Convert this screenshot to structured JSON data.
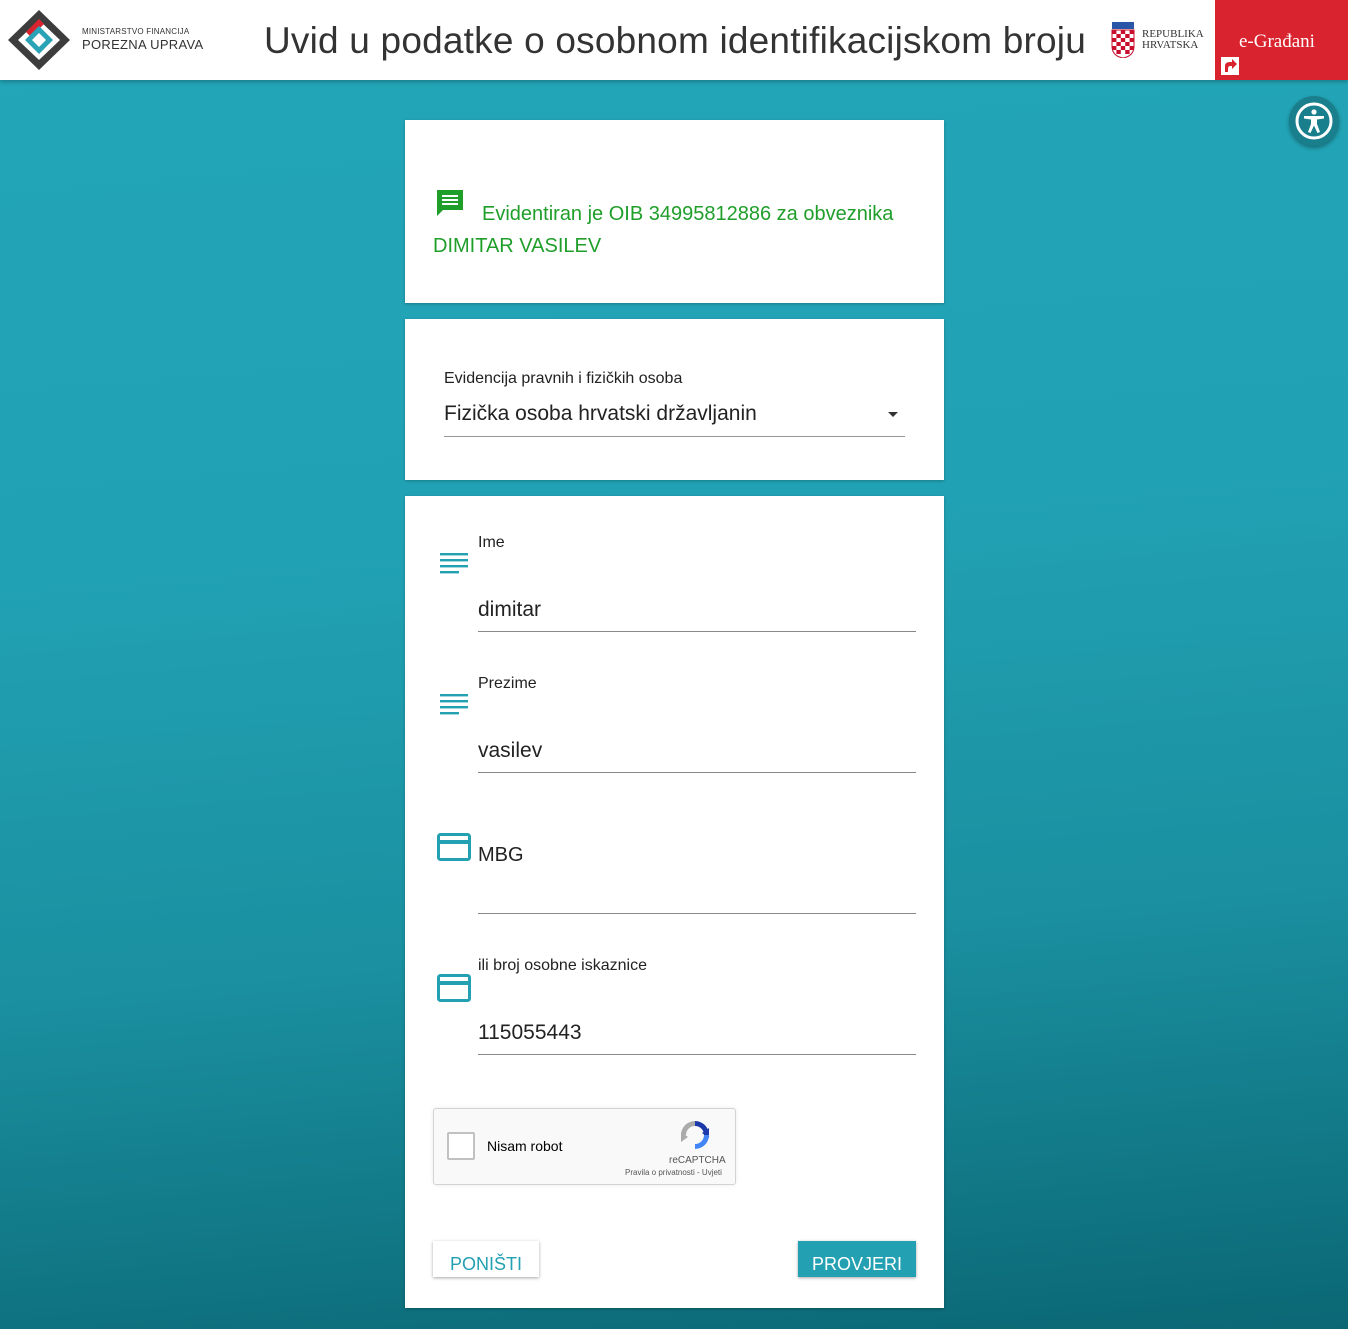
{
  "header": {
    "logo_small": "MINISTARSTVO FINANCIJA",
    "logo_big": "POREZNA UPRAVA",
    "title": "Uvid u podatke o osobnom identifikacijskom broju",
    "republic_line1": "REPUBLIKA",
    "republic_line2": "HRVATSKA",
    "egradani_label": "e-Građani"
  },
  "result": {
    "message": "Evidentiran je OIB 34995812886 za obveznika DIMITAR VASILEV",
    "color": "#1f9e2a"
  },
  "registry": {
    "label": "Evidencija pravnih i fizičkih osoba",
    "selected": "Fizička osoba hrvatski državljanin"
  },
  "form": {
    "first_name": {
      "label": "Ime",
      "value": "dimitar"
    },
    "last_name": {
      "label": "Prezime",
      "value": "vasilev"
    },
    "mbg": {
      "label": "MBG",
      "value": ""
    },
    "id_card": {
      "label": "ili broj osobne iskaznice",
      "value": "115055443"
    }
  },
  "captcha": {
    "label": "Nisam robot",
    "brand": "reCAPTCHA",
    "links": "Pravila o privatnosti - Uvjeti"
  },
  "buttons": {
    "cancel": "PONIŠTI",
    "submit": "PROVJERI"
  },
  "colors": {
    "accent": "#23a0b2",
    "egradani_red": "#d9232e"
  }
}
